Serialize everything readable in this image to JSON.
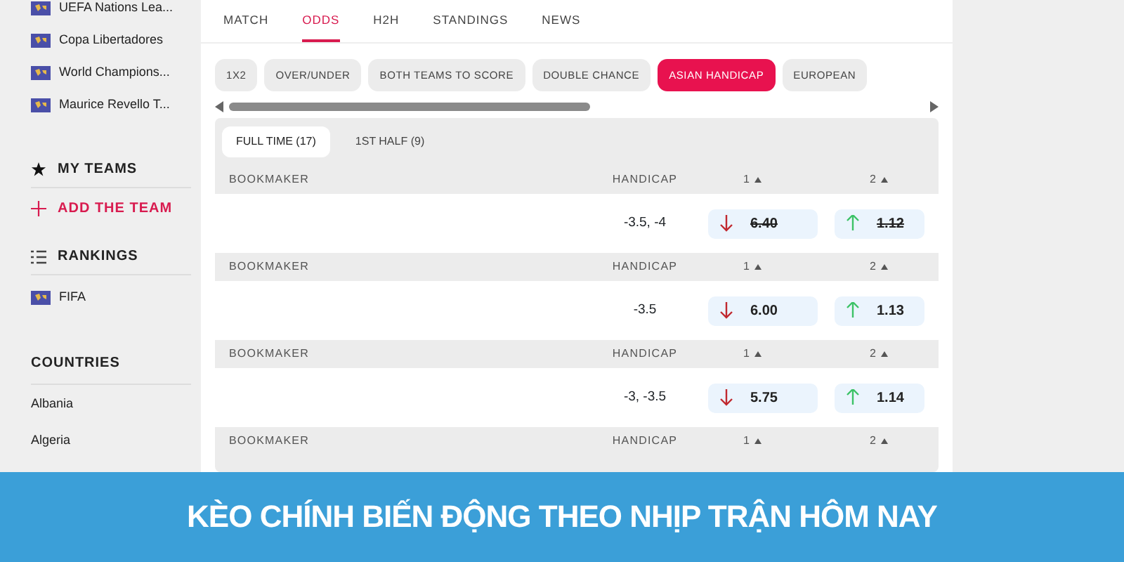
{
  "sidebar": {
    "competitions": [
      {
        "name": "UEFA Nations Lea..."
      },
      {
        "name": "Copa Libertadores"
      },
      {
        "name": "World Champions..."
      },
      {
        "name": "Maurice Revello T..."
      }
    ],
    "my_teams": {
      "title": "MY TEAMS",
      "add_label": "ADD THE TEAM"
    },
    "rankings": {
      "title": "RANKINGS",
      "items": [
        {
          "name": "FIFA"
        }
      ]
    },
    "countries": {
      "title": "COUNTRIES",
      "items": [
        "Albania",
        "Algeria"
      ]
    }
  },
  "tabs": [
    {
      "label": "MATCH",
      "selected": false
    },
    {
      "label": "ODDS",
      "selected": true
    },
    {
      "label": "H2H",
      "selected": false
    },
    {
      "label": "STANDINGS",
      "selected": false
    },
    {
      "label": "NEWS",
      "selected": false
    }
  ],
  "markets": [
    {
      "label": "1X2",
      "selected": false
    },
    {
      "label": "OVER/UNDER",
      "selected": false
    },
    {
      "label": "BOTH TEAMS TO SCORE",
      "selected": false
    },
    {
      "label": "DOUBLE CHANCE",
      "selected": false
    },
    {
      "label": "ASIAN HANDICAP",
      "selected": true
    },
    {
      "label": "EUROPEAN",
      "selected": false
    }
  ],
  "periods": [
    {
      "label": "FULL TIME (17)",
      "selected": true
    },
    {
      "label": "1ST HALF (9)",
      "selected": false
    }
  ],
  "groups": [
    {
      "columns": [
        "BOOKMAKER",
        "HANDICAP",
        "1",
        "2"
      ],
      "handicap": "-3.5, -4",
      "odds": [
        {
          "value": "6.40",
          "kind": "down",
          "struck": true
        },
        {
          "value": "1.12",
          "kind": "up",
          "struck": true
        }
      ]
    },
    {
      "columns": [
        "BOOKMAKER",
        "HANDICAP",
        "1",
        "2"
      ],
      "handicap": "-3.5",
      "odds": [
        {
          "value": "6.00",
          "kind": "down",
          "struck": false
        },
        {
          "value": "1.13",
          "kind": "up",
          "struck": false
        }
      ]
    },
    {
      "columns": [
        "BOOKMAKER",
        "HANDICAP",
        "1",
        "2"
      ],
      "handicap": "-3, -3.5",
      "odds": [
        {
          "value": "5.75",
          "kind": "down",
          "struck": false
        },
        {
          "value": "1.14",
          "kind": "up",
          "struck": false
        }
      ]
    },
    {
      "columns": [
        "BOOKMAKER",
        "HANDICAP",
        "1",
        "2"
      ]
    }
  ],
  "banner": {
    "title": "KÈO CHÍNH BIẾN ĐỘNG THEO NHỊP TRẬN HÔM NAY"
  }
}
